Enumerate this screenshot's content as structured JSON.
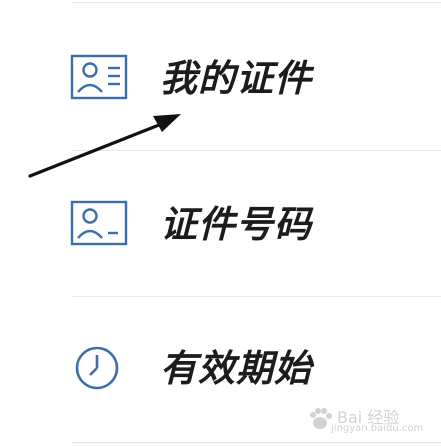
{
  "menu": {
    "items": [
      {
        "label": "我的证件",
        "icon": "id-card-lines-icon"
      },
      {
        "label": "证件号码",
        "icon": "id-card-dash-icon"
      },
      {
        "label": "有效期始",
        "icon": "clock-icon"
      }
    ]
  },
  "watermark": {
    "text": "Bai 经验",
    "url": "jingyan.baidu.com"
  },
  "colors": {
    "icon_blue": "#3d6ea8",
    "label_text": "#1c1c1c",
    "divider": "#e7e7e7",
    "annotation": "#111111"
  }
}
